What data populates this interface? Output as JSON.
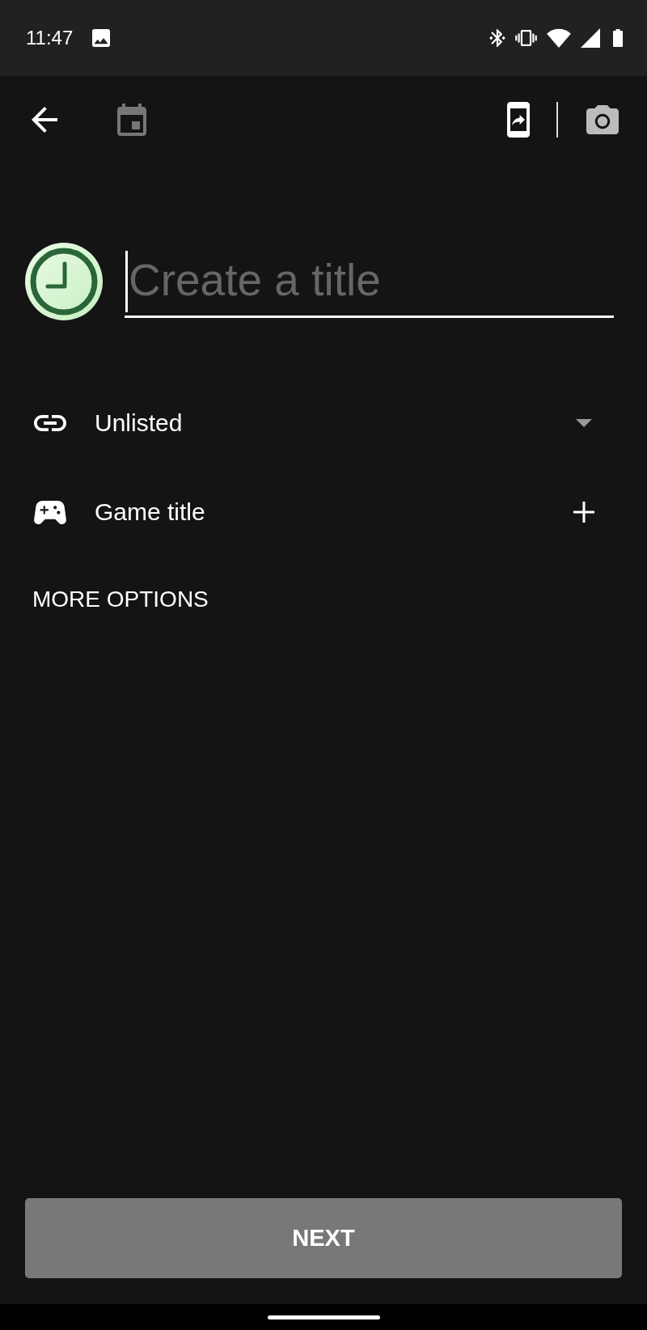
{
  "status_bar": {
    "time": "11:47"
  },
  "title_field": {
    "placeholder": "Create a title",
    "focused": true
  },
  "options": [
    {
      "kind": "visibility",
      "label": "Unlisted"
    },
    {
      "kind": "game",
      "label": "Game title"
    }
  ],
  "more_options": "MORE OPTIONS",
  "next_button": {
    "label": "NEXT",
    "disabled": true
  }
}
